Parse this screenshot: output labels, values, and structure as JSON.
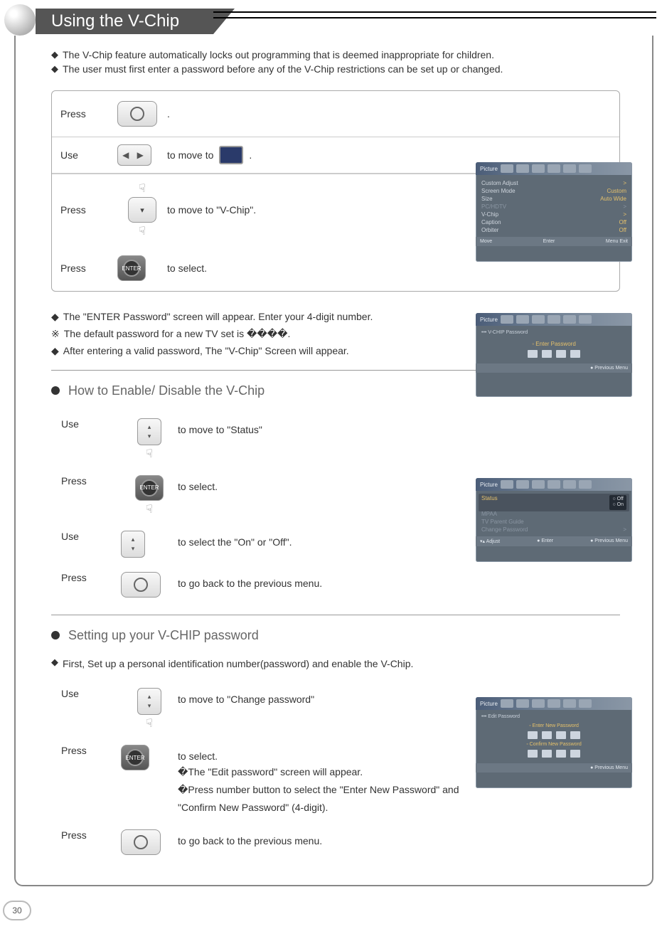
{
  "title": "Using the V-Chip",
  "intro": [
    "The V-Chip feature automatically locks out programming that is deemed inappropriate for children.",
    "The user must first enter a password before any of the V-Chip restrictions can be set up or changed."
  ],
  "steps_main": [
    {
      "verb": "Press",
      "btn": "menu",
      "after": "."
    },
    {
      "verb": "Use",
      "btn": "lr",
      "after_pre": "to move to",
      "tv_icon": true,
      "after_post": "."
    },
    {
      "verb": "Press",
      "btn": "down",
      "after": "to move to \"V-Chip\".",
      "hand_above": true,
      "hand_below": true
    },
    {
      "verb": "Press",
      "btn": "enter",
      "after": "to select."
    }
  ],
  "notes_pw": [
    {
      "mark": "◆",
      "text": "The \"ENTER Password\" screen will appear. Enter your 4-digit number."
    },
    {
      "mark": "※",
      "text": "The default password for a new TV set is ����."
    },
    {
      "mark": "◆",
      "text": "After entering a valid password, The \"V-Chip\" Screen will appear."
    }
  ],
  "sub1_title": "How to Enable/ Disable the V-Chip",
  "steps_sub1": [
    {
      "verb": "Use",
      "btn": "ud",
      "after": "to move to \"Status\"",
      "hand_below": true
    },
    {
      "verb": "Press",
      "btn": "enter",
      "after": "to select.",
      "hand_below": true
    },
    {
      "verb": "Use",
      "btn": "ud",
      "after": "to select the \"On\" or \"Off\"."
    },
    {
      "verb": "Press",
      "btn": "menu",
      "after": "to go back to the previous menu."
    }
  ],
  "sub2_title": "Setting up your V-CHIP password",
  "sub2_intro": "First, Set up a personal identification number(password) and enable the V-Chip.",
  "steps_sub2": [
    {
      "verb": "Use",
      "btn": "ud",
      "after": "to move to \"Change password\"",
      "hand_below": true
    },
    {
      "verb": "Press",
      "btn": "enter",
      "after": "to select.",
      "sub": [
        "�The \"Edit password\" screen will appear.",
        "�Press number button to select the \"Enter New Password\" and",
        "  \"Confirm New Password\" (4-digit)."
      ]
    },
    {
      "verb": "Press",
      "btn": "menu",
      "after": "to go back to the previous menu."
    }
  ],
  "osd1": {
    "header": "Picture",
    "rows": [
      {
        "k": "Custom Adjust",
        "v": ">"
      },
      {
        "k": "Screen Mode",
        "v": "Custom"
      },
      {
        "k": "Size",
        "v": "Auto Wide"
      },
      {
        "k": "PC/HDTV",
        "v": ">",
        "dim": true
      },
      {
        "k": "V-Chip",
        "v": ">"
      },
      {
        "k": "Caption",
        "v": "Off"
      },
      {
        "k": "Orbiter",
        "v": "Off"
      }
    ],
    "foot": {
      "l": "Move",
      "c": "Enter",
      "r": "Menu Exit"
    }
  },
  "osd2": {
    "header": "Picture",
    "crumb": "V-CHIP Password",
    "label": "Enter Password",
    "foot_r": "Previous Menu"
  },
  "osd3": {
    "header": "Picture",
    "rows": [
      {
        "k": "Status",
        "opt": [
          "Off",
          "On"
        ]
      },
      {
        "k": "MPAA",
        "dim": true
      },
      {
        "k": "TV Parent Guide",
        "dim": true
      },
      {
        "k": "Change Password",
        "v": ">",
        "dim": true
      }
    ],
    "foot": {
      "l": "Adjust",
      "c": "Enter",
      "r": "Previous Menu"
    }
  },
  "osd4": {
    "header": "Picture",
    "crumb": "Edit Password",
    "label1": "Enter New Password",
    "label2": "Confirm New Password",
    "foot_r": "Previous Menu"
  },
  "pagenum": "30"
}
